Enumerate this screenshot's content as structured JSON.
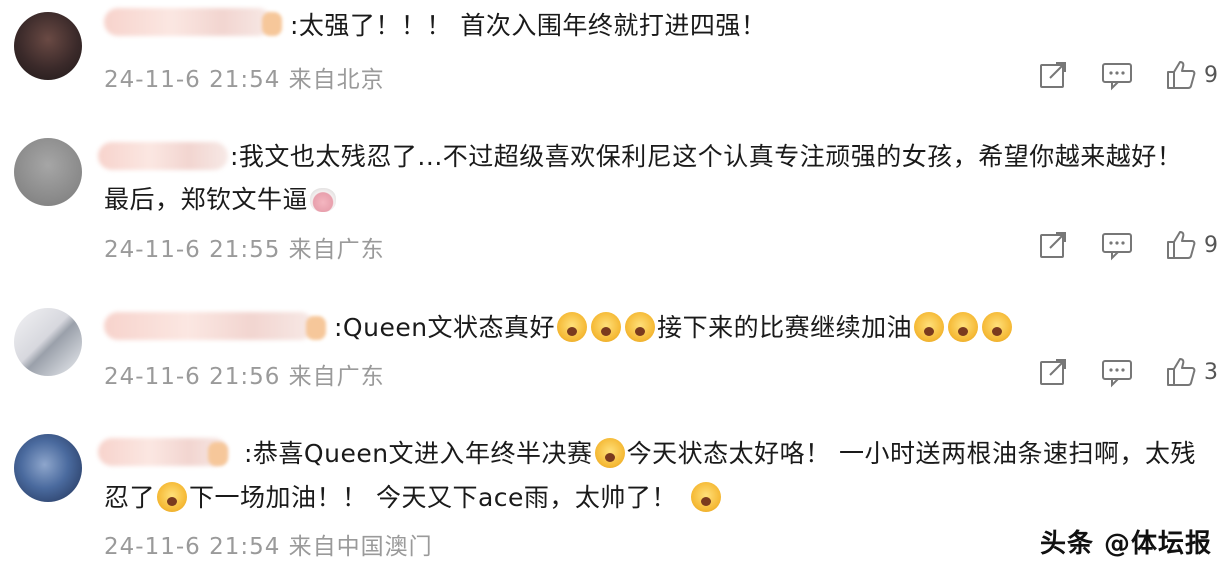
{
  "comments": [
    {
      "text_line1": ":太强了！！！ 首次入围年终就打进四强！",
      "text_line2": "",
      "meta": "24-11-6 21:54 来自北京",
      "likes": "9"
    },
    {
      "text_line1": ":我文也太残忍了...不过超级喜欢保利尼这个认真专注顽强的女孩，希望你越来越好！",
      "text_line2": "最后，郑钦文牛逼",
      "meta": "24-11-6 21:55 来自广东",
      "likes": "9"
    },
    {
      "text_line1_a": ":Queen文状态真好",
      "text_line1_b": "接下来的比赛继续加油",
      "meta": "24-11-6 21:56 来自广东",
      "likes": "3"
    },
    {
      "text_line1_a": ":恭喜Queen文进入年终半决赛",
      "text_line1_b": "今天状态太好咯！ 一小时送两根油条速扫啊，太残",
      "text_line2_a": "忍了",
      "text_line2_b": "下一场加油！！ 今天又下ace雨，太帅了！",
      "meta": "24-11-6 21:54 来自中国澳门",
      "likes": ""
    }
  ],
  "watermark": "头条 @体坛报",
  "icons": [
    "share-icon",
    "comment-icon",
    "thumbs-up-icon"
  ]
}
